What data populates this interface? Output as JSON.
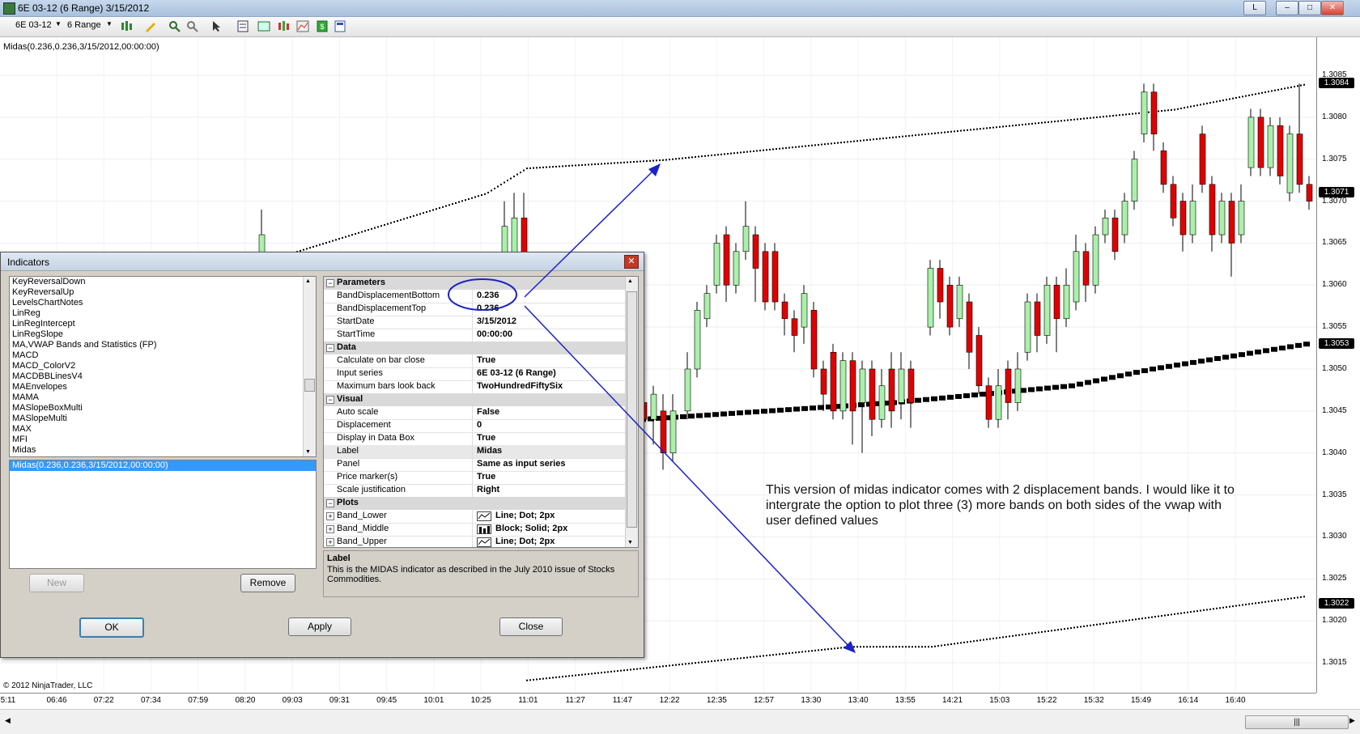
{
  "window": {
    "title": "6E 03-12 (6 Range)  3/15/2012",
    "buttons": [
      "L",
      "–",
      "□",
      "✕"
    ]
  },
  "toolbar": {
    "instrument": "6E 03-12",
    "period": "6 Range"
  },
  "indicator_label": "Midas(0.236,0.236,3/15/2012,00:00:00)",
  "copyright": "© 2012 NinjaTrader, LLC",
  "price_axis": {
    "labels": [
      "1.3085",
      "1.3080",
      "1.3075",
      "1.3070",
      "1.3065",
      "1.3060",
      "1.3055",
      "1.3050",
      "1.3045",
      "1.3040",
      "1.3035",
      "1.3030",
      "1.3025",
      "1.3020",
      "1.3015"
    ],
    "markers": [
      "1.3084",
      "1.3071",
      "1.3053",
      "1.3022"
    ]
  },
  "time_axis": [
    "5:11",
    "06:46",
    "07:22",
    "07:34",
    "07:59",
    "08:20",
    "09:03",
    "09:31",
    "09:45",
    "10:01",
    "10:25",
    "11:01",
    "11:27",
    "11:47",
    "12:22",
    "12:35",
    "12:57",
    "13:30",
    "13:40",
    "13:55",
    "14:21",
    "15:03",
    "15:22",
    "15:32",
    "15:49",
    "16:14",
    "16:40"
  ],
  "scrollbar": {
    "thumb": "|||"
  },
  "annotation": "This version of midas indicator comes with 2 displacement bands. I would like it to intergrate the option to plot three (3) more bands on both sides of the vwap with user defined values",
  "colors": {
    "band": "#000000",
    "up_candle": "#aaf0aa",
    "down_candle": "#e00000",
    "arrow": "#1c21c9"
  },
  "dialog": {
    "title": "Indicators",
    "close_icon": "✕",
    "available": [
      "KeyReversalDown",
      "KeyReversalUp",
      "LevelsChartNotes",
      "LinReg",
      "LinRegIntercept",
      "LinRegSlope",
      "MA,VWAP Bands and Statistics (FP)",
      "MACD",
      "MACD_ColorV2",
      "MACDBBLinesV4",
      "MAEnvelopes",
      "MAMA",
      "MASlopeBoxMulti",
      "MASlopeMulti",
      "MAX",
      "MFI",
      "Midas"
    ],
    "applied": [
      "Midas(0.236,0.236,3/15/2012,00:00:00)"
    ],
    "new_label": "New",
    "remove_label": "Remove",
    "ok_label": "OK",
    "apply_label": "Apply",
    "close_label": "Close",
    "properties": [
      {
        "type": "cat",
        "label": "Parameters"
      },
      {
        "type": "row",
        "k": "BandDisplacementBottom",
        "v": "0.236"
      },
      {
        "type": "row",
        "k": "BandDisplacementTop",
        "v": "0.236"
      },
      {
        "type": "row",
        "k": "StartDate",
        "v": "3/15/2012"
      },
      {
        "type": "row",
        "k": "StartTime",
        "v": "00:00:00"
      },
      {
        "type": "cat",
        "label": "Data"
      },
      {
        "type": "row",
        "k": "Calculate on bar close",
        "v": "True"
      },
      {
        "type": "row",
        "k": "Input series",
        "v": "6E 03-12 (6 Range)"
      },
      {
        "type": "row",
        "k": "Maximum bars look back",
        "v": "TwoHundredFiftySix"
      },
      {
        "type": "cat",
        "label": "Visual"
      },
      {
        "type": "row",
        "k": "Auto scale",
        "v": "False"
      },
      {
        "type": "row",
        "k": "Displacement",
        "v": "0"
      },
      {
        "type": "row",
        "k": "Display in Data Box",
        "v": "True"
      },
      {
        "type": "row",
        "k": "Label",
        "v": "Midas",
        "hl": true
      },
      {
        "type": "row",
        "k": "Panel",
        "v": "Same as input series"
      },
      {
        "type": "row",
        "k": "Price marker(s)",
        "v": "True"
      },
      {
        "type": "row",
        "k": "Scale justification",
        "v": "Right"
      },
      {
        "type": "cat",
        "label": "Plots"
      },
      {
        "type": "row",
        "k": "Band_Lower",
        "v": "Line; Dot; 2px",
        "pm": true,
        "icon": "line"
      },
      {
        "type": "row",
        "k": "Band_Middle",
        "v": "Block; Solid; 2px",
        "pm": true,
        "icon": "bar"
      },
      {
        "type": "row",
        "k": "Band_Upper",
        "v": "Line; Dot; 2px",
        "pm": true,
        "icon": "line"
      }
    ],
    "description_title": "Label",
    "description_text": "This is the MIDAS indicator as described in the July 2010 issue of Stocks Commodities."
  }
}
